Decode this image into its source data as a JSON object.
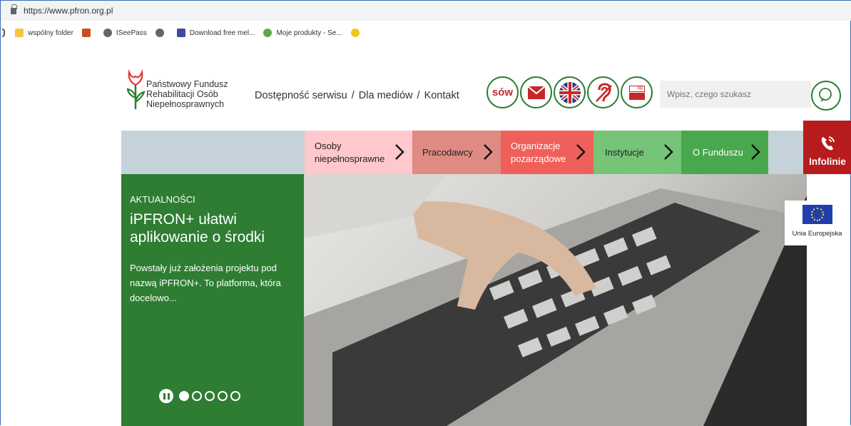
{
  "browser": {
    "url": "https://www.pfron.org.pl",
    "bookmarks": [
      {
        "label": "wspólny folder",
        "icon": "folder-icon"
      },
      {
        "label": "",
        "icon": "app-icon"
      },
      {
        "label": "ISeePass",
        "icon": "globe-icon"
      },
      {
        "label": "",
        "icon": "globe-icon"
      },
      {
        "label": "Download free mel...",
        "icon": "download-icon"
      },
      {
        "label": "Moje produkty - Se...",
        "icon": "globe-icon"
      },
      {
        "label": "",
        "icon": "mail-icon"
      }
    ]
  },
  "header": {
    "logo_lines": [
      "Państwowy Fundusz",
      "Rehabilitacji Osób",
      "Niepełnosprawnych"
    ],
    "links": [
      "Dostępność serwisu",
      "Dla mediów",
      "Kontakt"
    ],
    "separator": "/",
    "icon_buttons": [
      "sow-icon",
      "mail-icon",
      "uk-flag-icon",
      "hearing-icon",
      "bip-icon"
    ],
    "sow_text": "sów",
    "bip_text": "bip",
    "search_placeholder": "Wpisz, czego szukasz"
  },
  "nav": {
    "items": [
      {
        "label": "Osoby niepełnosprawne",
        "color": "#ffc8cc"
      },
      {
        "label": "Pracodawcy",
        "color": "#e08a84"
      },
      {
        "label": "Organizacje pozarządowe",
        "color": "#f0605a"
      },
      {
        "label": "Instytucje",
        "color": "#76c478"
      },
      {
        "label": "O Funduszu",
        "color": "#49a84e"
      }
    ],
    "infolinie": "Infolinie"
  },
  "hero": {
    "kicker": "AKTUALNOŚCI",
    "headline": "iPFRON+ ułatwi aplikowanie o środki",
    "lead": "Powstały już założenia projektu pod nazwą iPFRON+. To platforma, która docelowo...",
    "slides_total": 5,
    "slide_active": 1
  },
  "eu": {
    "label": "Unia Europejska"
  },
  "colors": {
    "brand_green": "#2e7d32",
    "infolinie_red": "#b71c1c"
  }
}
